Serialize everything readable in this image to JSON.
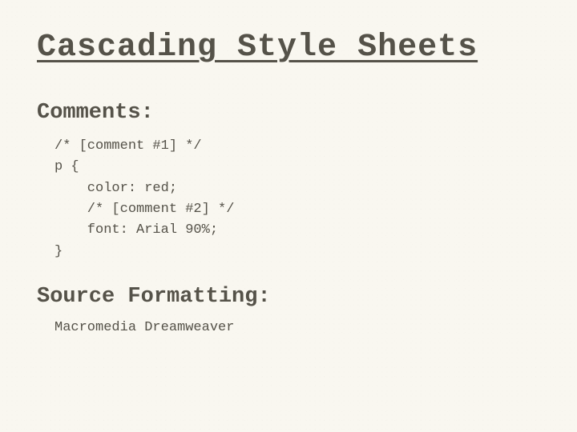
{
  "title": "Cascading Style Sheets",
  "sections": {
    "comments_heading": "Comments:",
    "code_line1": "/* [comment #1] */",
    "code_line2": "p {",
    "code_line3": "    color: red;",
    "code_line4": "    /* [comment #2] */",
    "code_line5": "    font: Arial 90%;",
    "code_line6": "}",
    "source_heading": "Source Formatting:",
    "source_text": "Macromedia Dreamweaver"
  }
}
